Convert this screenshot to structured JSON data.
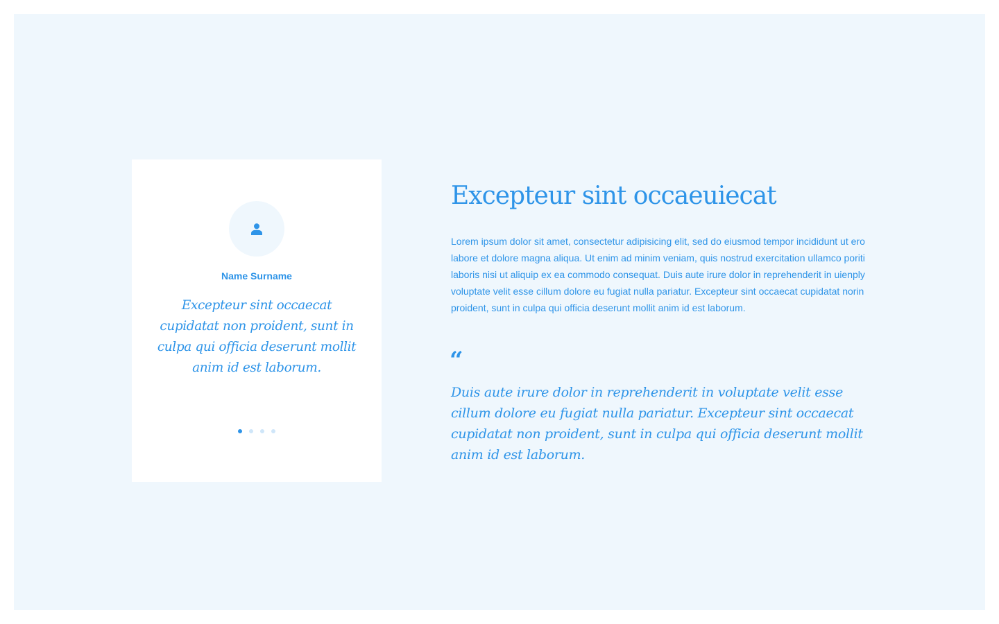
{
  "colors": {
    "accent": "#2e94e8",
    "section_background": "#eff7fd",
    "card_background": "#ffffff",
    "dot_inactive": "#cfe6f9"
  },
  "testimonial_card": {
    "avatar_icon": "user-icon",
    "name": "Name Surname",
    "quote": "Excepteur sint occaecat cupidatat non proident, sunt in culpa qui officia deserunt mollit anim id est laborum.",
    "pagination": {
      "count": 4,
      "active_index": 0
    }
  },
  "content": {
    "heading": "Excepteur sint occaeuiecat",
    "body": "Lorem ipsum dolor sit amet, consectetur adipisicing elit, sed do eiusmod tempor incididunt ut ero labore et dolore magna aliqua. Ut enim ad minim veniam, quis nostrud exercitation ullamco poriti laboris nisi ut aliquip ex ea commodo consequat. Duis aute irure dolor in reprehenderit in uienply voluptate velit esse cillum dolore eu fugiat nulla pariatur. Excepteur sint occaecat cupidatat norin proident, sunt in culpa qui officia deserunt mollit anim id est laborum.",
    "quote_icon": "quote-icon",
    "quote_mark": "“",
    "pull_quote": "Duis aute irure dolor in reprehenderit in voluptate velit esse cillum dolore eu fugiat nulla pariatur. Excepteur sint occaecat cupidatat non proident, sunt in culpa qui officia deserunt mollit anim id est laborum."
  }
}
